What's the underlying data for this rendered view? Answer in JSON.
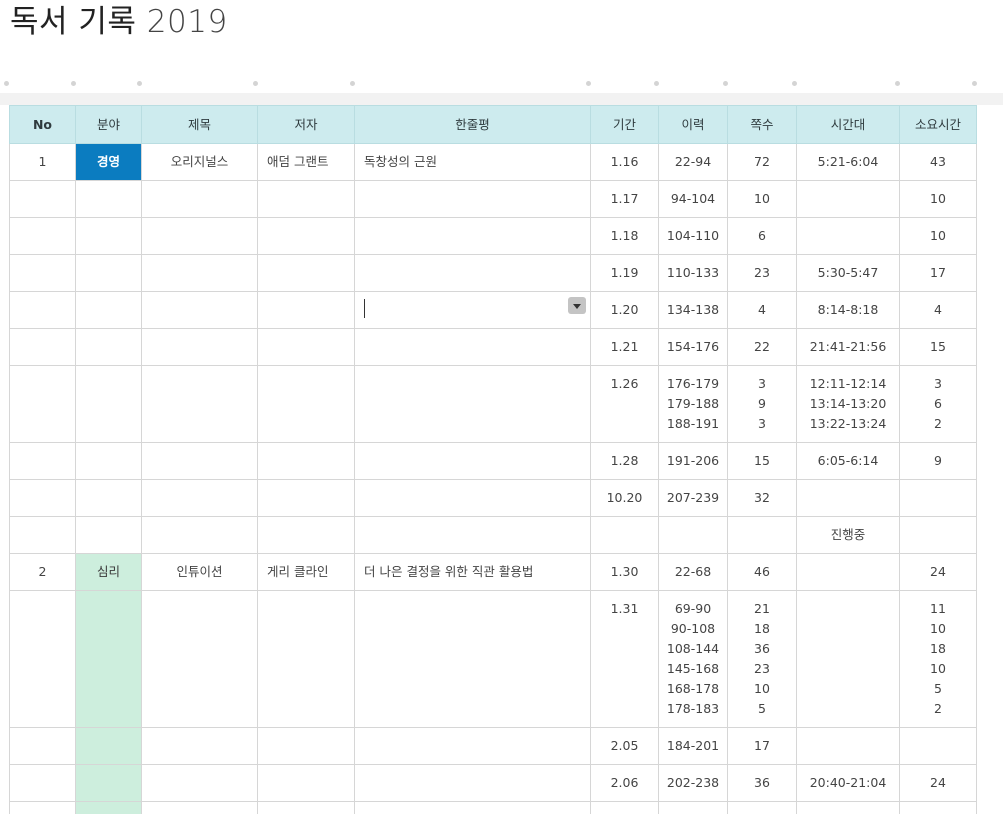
{
  "title": {
    "main": "독서 기록",
    "year": "2019"
  },
  "colors": {
    "header_bg": "#cdebee",
    "tag_business": "#0b7cc0",
    "tag_psych": "#cdeedd"
  },
  "table": {
    "columns": [
      "No",
      "분야",
      "제목",
      "저자",
      "한줄평",
      "기간",
      "이력",
      "쪽수",
      "시간대",
      "소요시간"
    ],
    "rows": [
      {
        "no": "1",
        "field": "경영",
        "title": "오리지널스",
        "author": "애덤 그랜트",
        "review": "독창성의 근원",
        "period": "1.16",
        "range": [
          "22-94"
        ],
        "pages": [
          "72"
        ],
        "time": [
          "5:21-6:04"
        ],
        "duration": [
          "43"
        ]
      },
      {
        "no": "",
        "field": "",
        "title": "",
        "author": "",
        "review": "",
        "period": "1.17",
        "range": [
          "94-104"
        ],
        "pages": [
          "10"
        ],
        "time": [
          ""
        ],
        "duration": [
          "10"
        ]
      },
      {
        "no": "",
        "field": "",
        "title": "",
        "author": "",
        "review": "",
        "period": "1.18",
        "range": [
          "104-110"
        ],
        "pages": [
          "6"
        ],
        "time": [
          ""
        ],
        "duration": [
          "10"
        ]
      },
      {
        "no": "",
        "field": "",
        "title": "",
        "author": "",
        "review": "",
        "period": "1.19",
        "range": [
          "110-133"
        ],
        "pages": [
          "23"
        ],
        "time": [
          "5:30-5:47"
        ],
        "duration": [
          "17"
        ]
      },
      {
        "no": "",
        "field": "",
        "title": "",
        "author": "",
        "review": "",
        "period": "1.20",
        "range": [
          "134-138"
        ],
        "pages": [
          "4"
        ],
        "time": [
          "8:14-8:18"
        ],
        "duration": [
          "4"
        ]
      },
      {
        "no": "",
        "field": "",
        "title": "",
        "author": "",
        "review": "",
        "period": "1.21",
        "range": [
          "154-176"
        ],
        "pages": [
          "22"
        ],
        "time": [
          "21:41-21:56"
        ],
        "duration": [
          "15"
        ]
      },
      {
        "no": "",
        "field": "",
        "title": "",
        "author": "",
        "review": "",
        "period": "1.26",
        "range": [
          "176-179",
          "179-188",
          "188-191"
        ],
        "pages": [
          "3",
          "9",
          "3"
        ],
        "time": [
          "12:11-12:14",
          "13:14-13:20",
          "13:22-13:24"
        ],
        "duration": [
          "3",
          "6",
          "2"
        ]
      },
      {
        "no": "",
        "field": "",
        "title": "",
        "author": "",
        "review": "",
        "period": "1.28",
        "range": [
          "191-206"
        ],
        "pages": [
          "15"
        ],
        "time": [
          "6:05-6:14"
        ],
        "duration": [
          "9"
        ]
      },
      {
        "no": "",
        "field": "",
        "title": "",
        "author": "",
        "review": "",
        "period": "10.20",
        "range": [
          "207-239"
        ],
        "pages": [
          "32"
        ],
        "time": [
          ""
        ],
        "duration": [
          ""
        ]
      },
      {
        "no": "",
        "field": "",
        "title": "",
        "author": "",
        "review": "",
        "period": "",
        "range": [
          ""
        ],
        "pages": [
          ""
        ],
        "time": [
          "진행중"
        ],
        "duration": [
          ""
        ]
      },
      {
        "no": "2",
        "field": "심리",
        "title": "인튜이션",
        "author": "게리 클라인",
        "review": "더 나은 결정을 위한 직관 활용법",
        "period": "1.30",
        "range": [
          "22-68"
        ],
        "pages": [
          "46"
        ],
        "time": [
          ""
        ],
        "duration": [
          "24"
        ]
      },
      {
        "no": "",
        "field": "",
        "title": "",
        "author": "",
        "review": "",
        "period": "1.31",
        "range": [
          "69-90",
          "90-108",
          "108-144",
          "145-168",
          "168-178",
          "178-183"
        ],
        "pages": [
          "21",
          "18",
          "36",
          "23",
          "10",
          "5"
        ],
        "time": [
          ""
        ],
        "duration": [
          "11",
          "10",
          "18",
          "10",
          "5",
          "2"
        ]
      },
      {
        "no": "",
        "field": "",
        "title": "",
        "author": "",
        "review": "",
        "period": "2.05",
        "range": [
          "184-201"
        ],
        "pages": [
          "17"
        ],
        "time": [
          ""
        ],
        "duration": [
          ""
        ]
      },
      {
        "no": "",
        "field": "",
        "title": "",
        "author": "",
        "review": "",
        "period": "2.06",
        "range": [
          "202-238"
        ],
        "pages": [
          "36"
        ],
        "time": [
          "20:40-21:04"
        ],
        "duration": [
          "24"
        ]
      },
      {
        "no": "",
        "field": "",
        "title": "",
        "author": "",
        "review": "",
        "period": "",
        "range": [
          ""
        ],
        "pages": [
          ""
        ],
        "time": [
          ""
        ],
        "duration": [
          ""
        ]
      }
    ]
  }
}
